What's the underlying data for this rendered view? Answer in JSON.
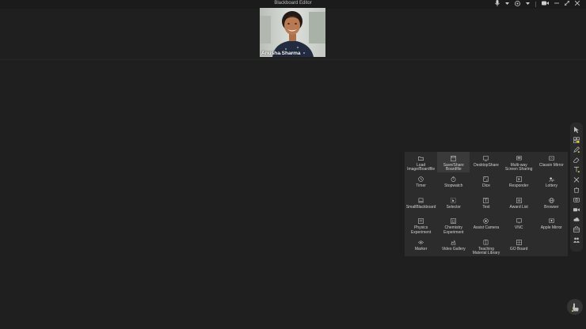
{
  "window": {
    "title": "Blackboard Editor"
  },
  "top_controls": {
    "icons": [
      "microphone-icon",
      "chevron-down-icon",
      "speaker-icon",
      "chevron-down-icon",
      "camera-icon",
      "minimize-icon",
      "restore-icon",
      "close-icon"
    ]
  },
  "participant": {
    "name": "Anusha Sharma"
  },
  "toolbox": {
    "tools": [
      {
        "id": "load-image",
        "label": "Load\nImage/Boardfile",
        "icon": "folder-icon",
        "active": false
      },
      {
        "id": "save-share",
        "label": "Save/Share\nBoardfile",
        "icon": "save-icon",
        "active": true
      },
      {
        "id": "desktop-share",
        "label": "DesktopShare",
        "icon": "monitor-icon",
        "active": false
      },
      {
        "id": "multi-way",
        "label": "Multi-way\nScreen Sharing",
        "icon": "multi-screen-icon",
        "active": false
      },
      {
        "id": "classin-mirror",
        "label": "Classin Mirror",
        "icon": "mirror-icon",
        "active": false
      },
      {
        "id": "timer",
        "label": "Timer",
        "icon": "timer-icon",
        "active": false
      },
      {
        "id": "stopwatch",
        "label": "Stopwatch",
        "icon": "stopwatch-icon",
        "active": false
      },
      {
        "id": "dice",
        "label": "Dice",
        "icon": "dice-icon",
        "active": false
      },
      {
        "id": "responder",
        "label": "Responder",
        "icon": "responder-icon",
        "active": false
      },
      {
        "id": "lottery",
        "label": "Lottery",
        "icon": "lottery-icon",
        "active": false
      },
      {
        "id": "small-blackboard",
        "label": "SmallBlackboard",
        "icon": "laptop-icon",
        "active": false
      },
      {
        "id": "selector",
        "label": "Selector",
        "icon": "selector-icon",
        "active": false
      },
      {
        "id": "text",
        "label": "Text",
        "icon": "text-icon",
        "active": false
      },
      {
        "id": "award-list",
        "label": "Award List",
        "icon": "award-icon",
        "active": false
      },
      {
        "id": "browser",
        "label": "Browser",
        "icon": "globe-icon",
        "active": false
      },
      {
        "id": "physics",
        "label": "Physics\nExperiment",
        "icon": "physics-icon",
        "active": false
      },
      {
        "id": "chemistry",
        "label": "Chemistry\nExperiment",
        "icon": "chemistry-icon",
        "active": false
      },
      {
        "id": "assist-camera",
        "label": "Assist Camera",
        "icon": "camera-icon",
        "active": false
      },
      {
        "id": "vnc",
        "label": "VNC",
        "icon": "vnc-icon",
        "active": false
      },
      {
        "id": "apple-mirror",
        "label": "Apple Mirror",
        "icon": "apple-icon",
        "active": false
      },
      {
        "id": "marker",
        "label": "Marker",
        "icon": "eye-icon",
        "active": false
      },
      {
        "id": "video-gallery",
        "label": "Video Gallery",
        "icon": "gallery-icon",
        "active": false
      },
      {
        "id": "teaching-material",
        "label": "Teaching\nMaterial Library",
        "icon": "library-icon",
        "active": false
      },
      {
        "id": "go-board",
        "label": "GO Board",
        "icon": "go-board-icon",
        "active": false
      }
    ]
  },
  "sidebar": {
    "tools": [
      "pointer-icon",
      "toolbox-icon",
      "pen-icon",
      "eraser-icon",
      "text-tool-icon",
      "close-tool-icon",
      "trash-icon",
      "camera-tool-icon",
      "video-icon",
      "cloud-icon",
      "lab-icon",
      "users-icon"
    ]
  },
  "colors": {
    "background": "#1f1f1f",
    "panel": "#2c2c2c",
    "accent": "#e3d232"
  }
}
